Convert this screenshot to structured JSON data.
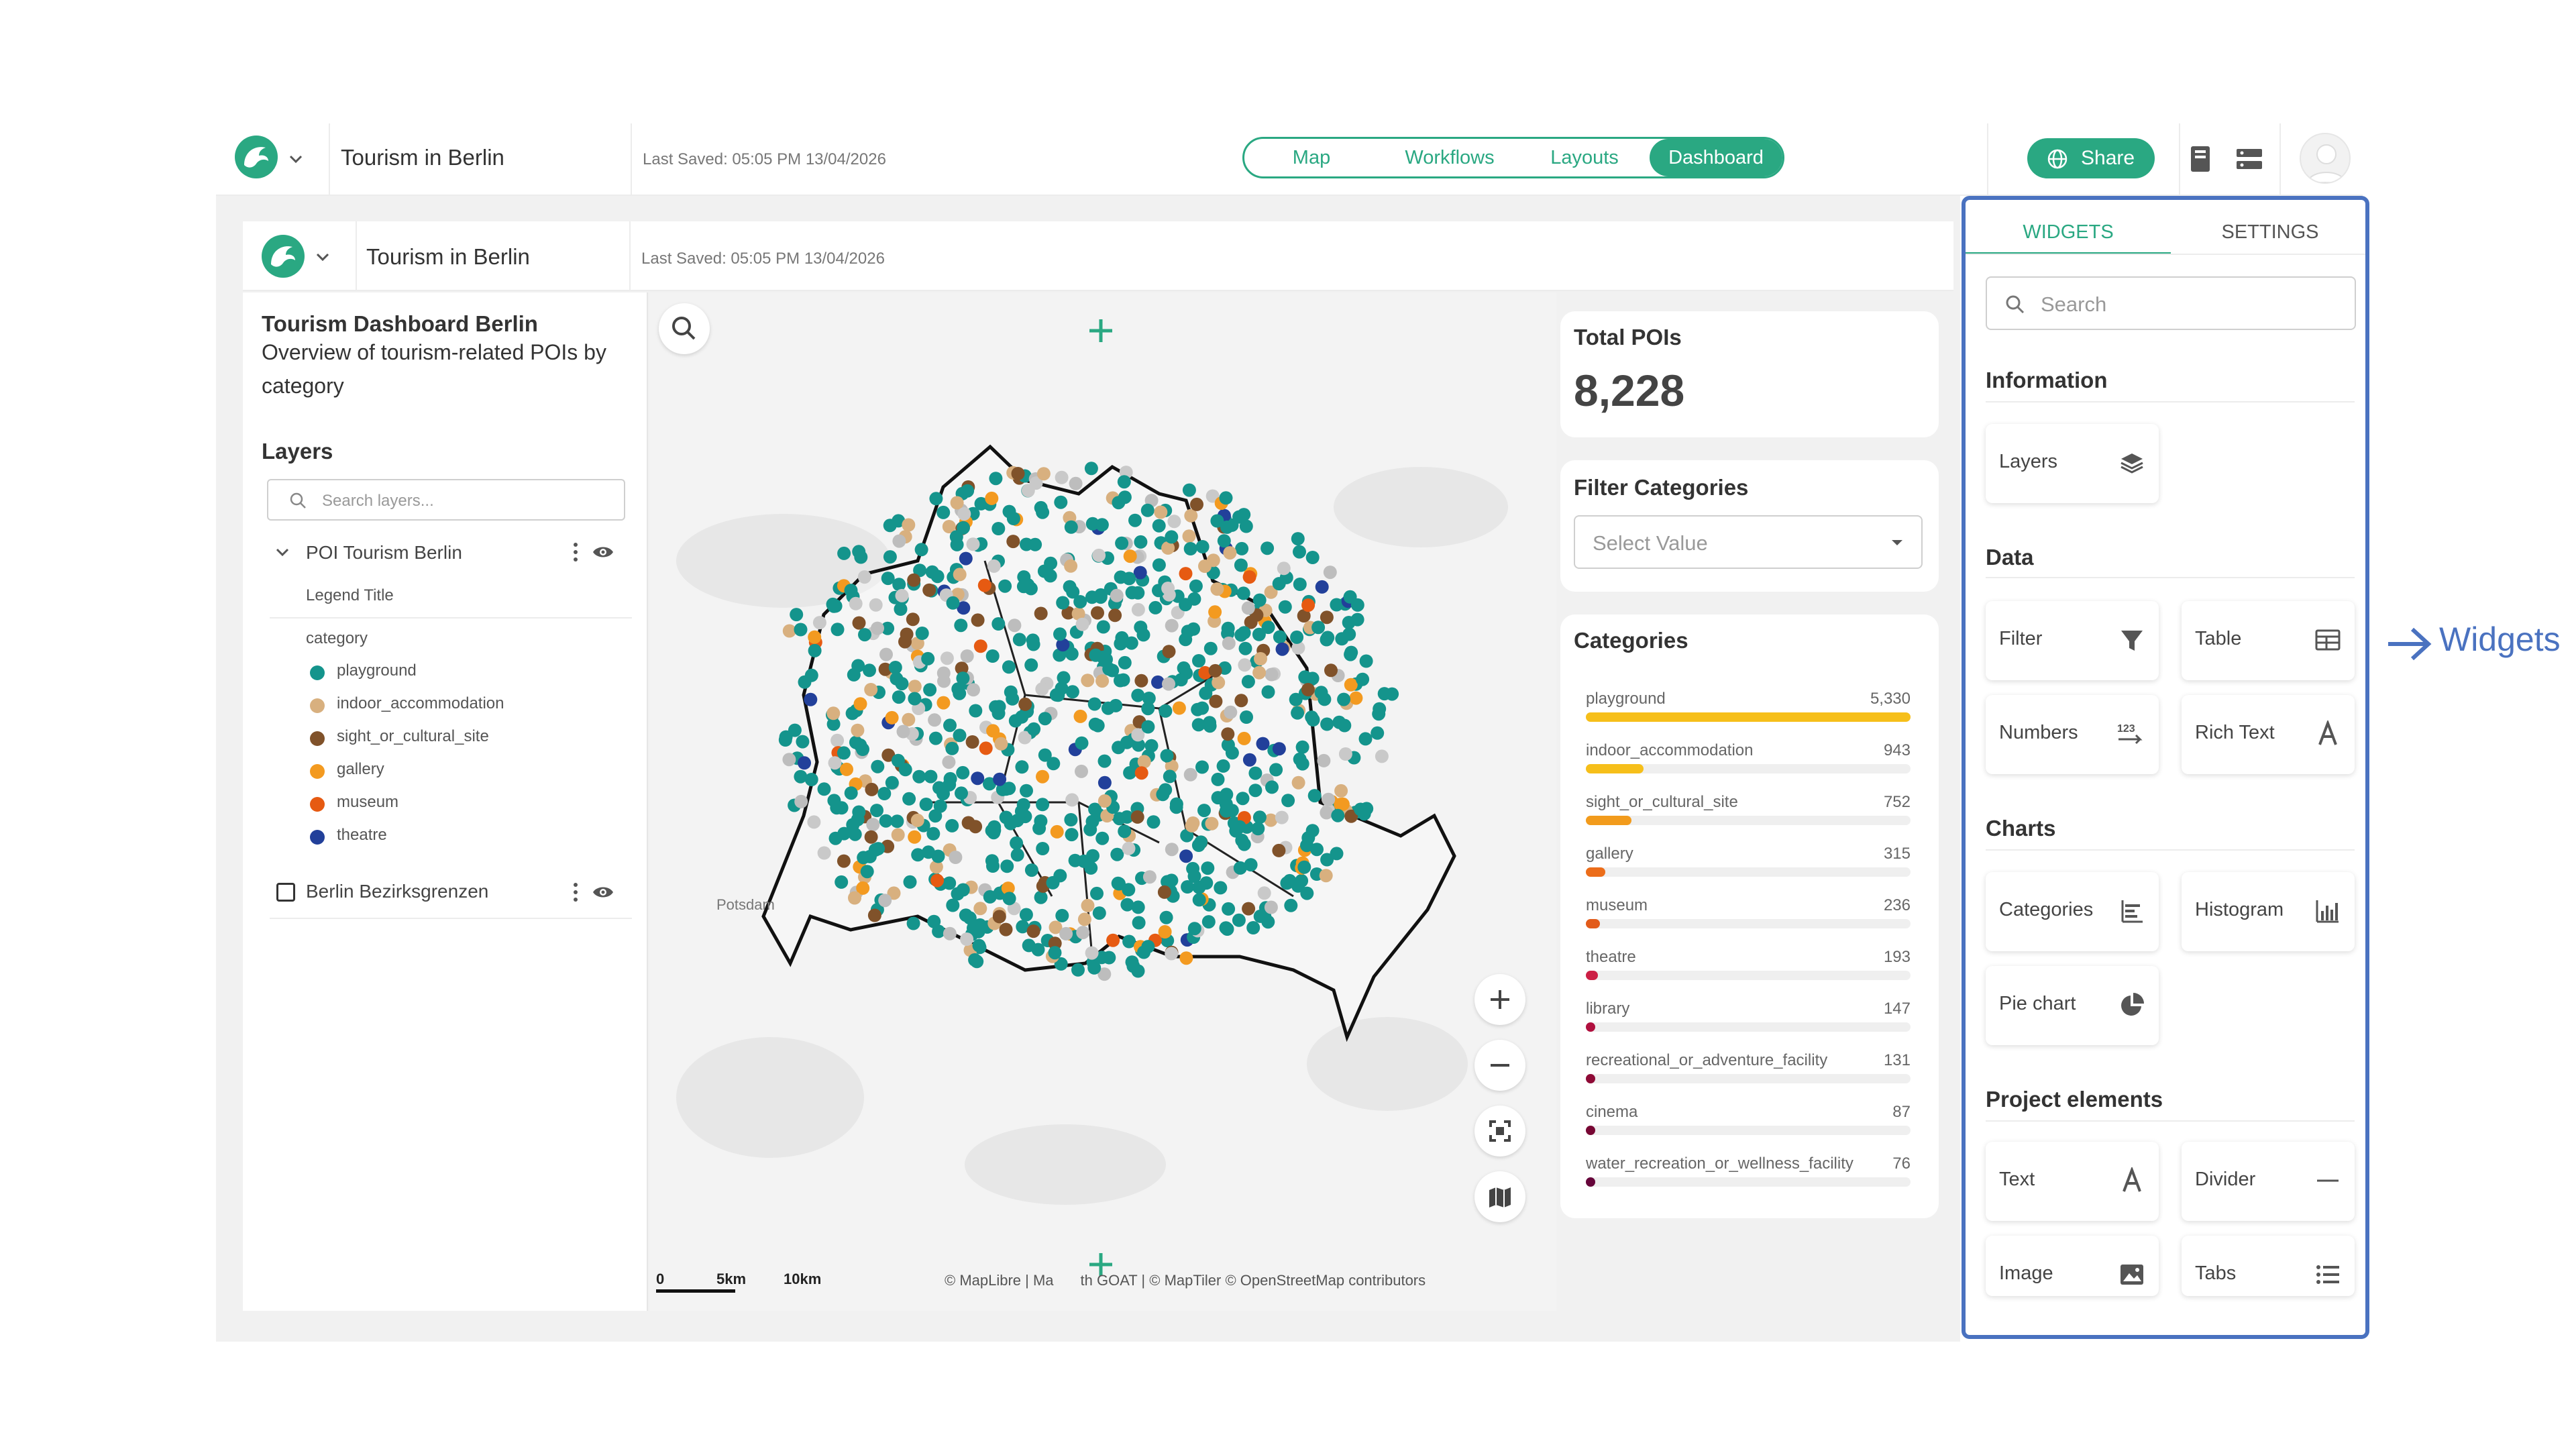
{
  "app": {
    "project_title": "Tourism in Berlin",
    "last_saved": "Last Saved: 05:05 PM 13/04/2026",
    "tabs": [
      {
        "label": "Map"
      },
      {
        "label": "Workflows"
      },
      {
        "label": "Layouts"
      },
      {
        "label": "Dashboard"
      }
    ],
    "active_tab": "Dashboard",
    "share_label": "Share",
    "colors": {
      "accent": "#2aa882",
      "annotation": "#4a72c0"
    }
  },
  "dashboard": {
    "title": "Tourism in Berlin",
    "last_saved": "Last Saved: 05:05 PM 13/04/2026",
    "info": {
      "heading": "Tourism Dashboard Berlin",
      "line1": "Overview of tourism-related POIs by",
      "line2": "category"
    },
    "layers": {
      "heading": "Layers",
      "search_placeholder": "Search layers...",
      "items": [
        {
          "name": "POI Tourism Berlin",
          "legend_title": "Legend Title",
          "attribute": "category"
        },
        {
          "name": "Berlin Bezirksgrenzen"
        }
      ],
      "legend": [
        {
          "label": "playground",
          "color": "#14948c"
        },
        {
          "label": "indoor_accommodation",
          "color": "#d8b07f"
        },
        {
          "label": "sight_or_cultural_site",
          "color": "#80522a"
        },
        {
          "label": "gallery",
          "color": "#f39a20"
        },
        {
          "label": "museum",
          "color": "#e65a12"
        },
        {
          "label": "theatre",
          "color": "#22409a"
        }
      ]
    },
    "map": {
      "place_label": "Potsdam",
      "attribution": "© MapLibre | Ma",
      "attribution2": "th GOAT | © MapTiler © OpenStreetMap contributors",
      "scale": [
        "0",
        "5km",
        "10km"
      ]
    },
    "total_pois": {
      "heading": "Total POIs",
      "value": "8,228"
    },
    "filter": {
      "heading": "Filter Categories",
      "placeholder": "Select Value"
    },
    "categories": {
      "heading": "Categories",
      "max": 5330,
      "items": [
        {
          "name": "playground",
          "display": "5,330",
          "value": 5330,
          "color": "#f6bf1a"
        },
        {
          "name": "indoor_accommodation",
          "display": "943",
          "value": 943,
          "color": "#f6bf1a"
        },
        {
          "name": "sight_or_cultural_site",
          "display": "752",
          "value": 752,
          "color": "#f29b1c"
        },
        {
          "name": "gallery",
          "display": "315",
          "value": 315,
          "color": "#ec6d1a"
        },
        {
          "name": "museum",
          "display": "236",
          "value": 236,
          "color": "#e25b1a"
        },
        {
          "name": "theatre",
          "display": "193",
          "value": 193,
          "color": "#cc1f45"
        },
        {
          "name": "library",
          "display": "147",
          "value": 147,
          "color": "#b0103e"
        },
        {
          "name": "recreational_or_adventure_facility",
          "display": "131",
          "value": 131,
          "color": "#8e0a36"
        },
        {
          "name": "cinema",
          "display": "87",
          "value": 87,
          "color": "#770633"
        },
        {
          "name": "water_recreation_or_wellness_facility",
          "display": "76",
          "value": 76,
          "color": "#66053a"
        }
      ]
    }
  },
  "right_panel": {
    "tabs": [
      "WIDGETS",
      "SETTINGS"
    ],
    "search_placeholder": "Search",
    "sections": [
      {
        "heading": "Information",
        "widgets": [
          {
            "label": "Layers",
            "icon": "layers-icon"
          }
        ]
      },
      {
        "heading": "Data",
        "widgets": [
          {
            "label": "Filter",
            "icon": "filter-icon"
          },
          {
            "label": "Table",
            "icon": "table-icon"
          },
          {
            "label": "Numbers",
            "icon": "numbers-icon"
          },
          {
            "label": "Rich Text",
            "icon": "rich-text-icon"
          }
        ]
      },
      {
        "heading": "Charts",
        "widgets": [
          {
            "label": "Categories",
            "icon": "categories-chart-icon"
          },
          {
            "label": "Histogram",
            "icon": "histogram-icon"
          },
          {
            "label": "Pie chart",
            "icon": "pie-chart-icon"
          }
        ]
      },
      {
        "heading": "Project elements",
        "widgets": [
          {
            "label": "Text",
            "icon": "text-icon"
          },
          {
            "label": "Divider",
            "icon": "divider-icon"
          },
          {
            "label": "Image",
            "icon": "image-icon"
          },
          {
            "label": "Tabs",
            "icon": "tabs-icon"
          }
        ]
      }
    ]
  },
  "annotation": {
    "label": "Widgets"
  }
}
